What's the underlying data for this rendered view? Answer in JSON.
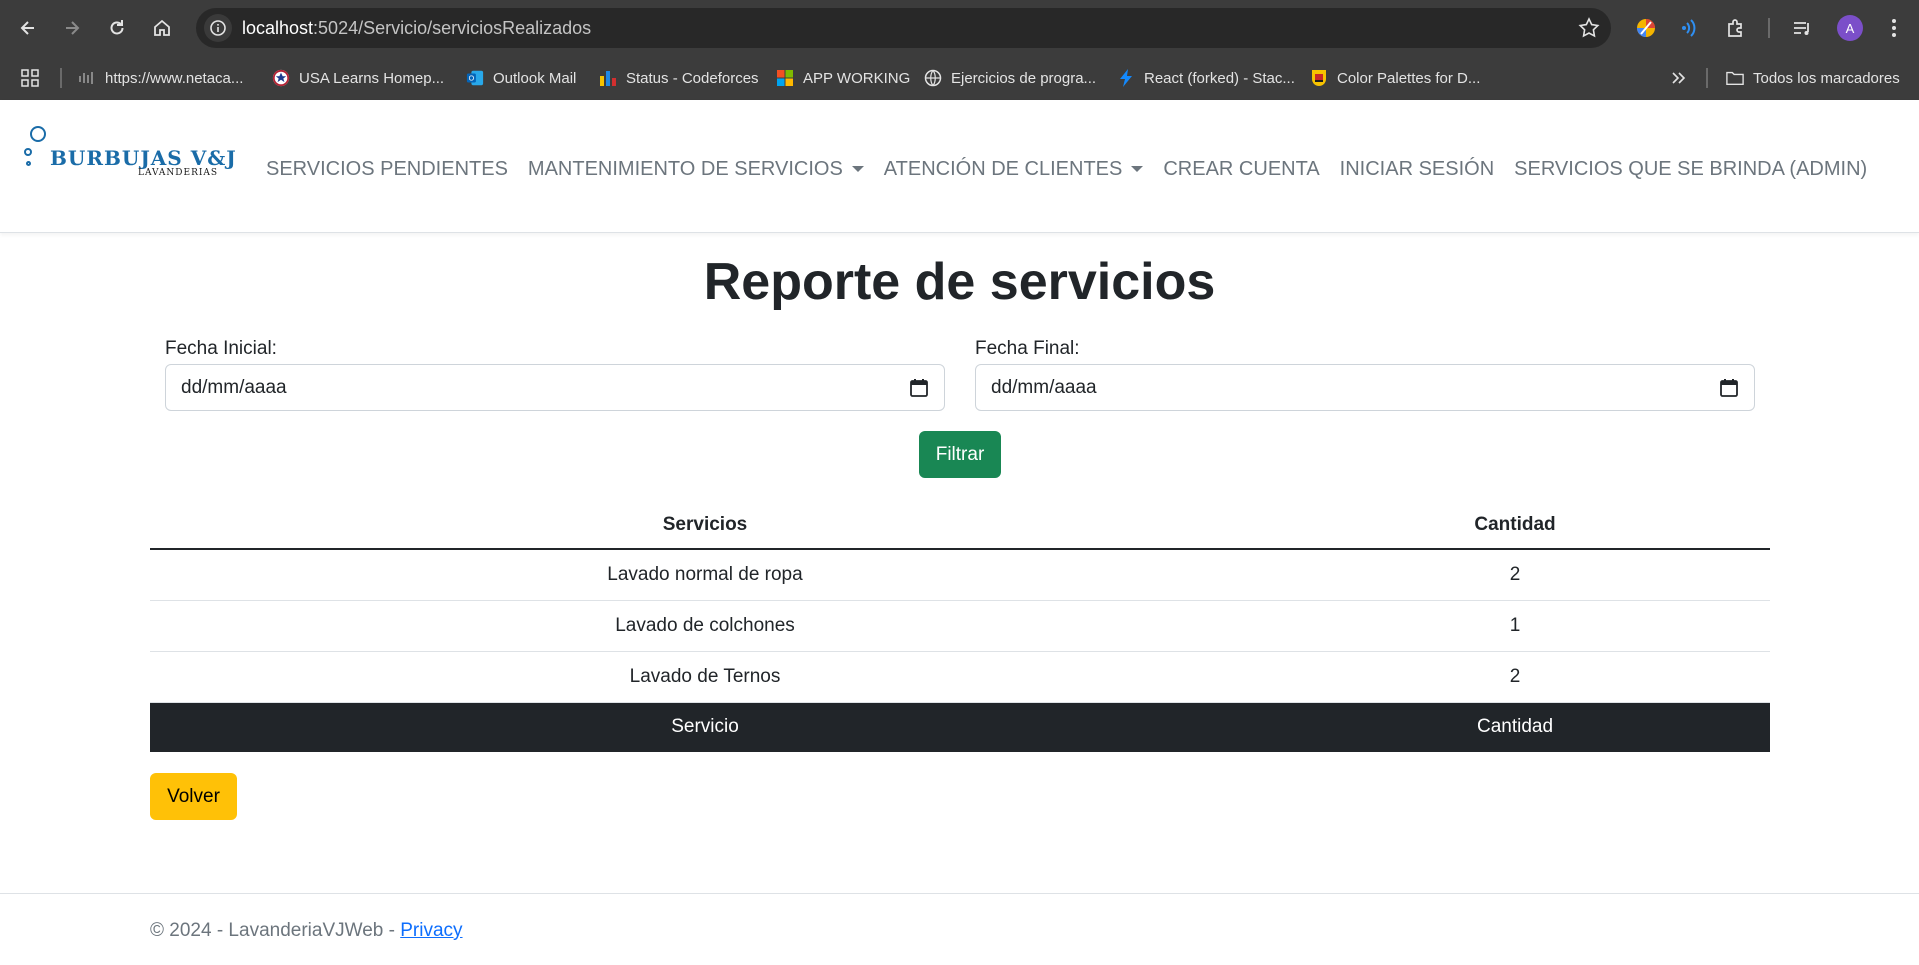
{
  "browser": {
    "url_host": "localhost",
    "url_path": ":5024/Servicio/serviciosRealizados",
    "profile_initial": "A",
    "bookmarks": [
      "https://www.netaca...",
      "USA Learns Homep...",
      "Outlook Mail",
      "Status - Codeforces",
      "APP WORKING",
      "Ejercicios de progra...",
      "React (forked) - Stac...",
      "Color Palettes for D..."
    ],
    "all_bookmarks": "Todos los marcadores"
  },
  "navbar": {
    "brand_name": "BURBUJAS V&J",
    "brand_sub": "LAVANDERIAS",
    "links": [
      "SERVICIOS PENDIENTES",
      "MANTENIMIENTO DE SERVICIOS",
      "ATENCIÓN DE CLIENTES",
      "CREAR CUENTA",
      "INICIAR SESIÓN",
      "SERVICIOS QUE SE BRINDA (ADMIN)"
    ]
  },
  "main": {
    "title": "Reporte de servicios",
    "start_label": "Fecha Inicial:",
    "start_value": "dd/mm/aaaa",
    "end_label": "Fecha Final:",
    "end_value": "dd/mm/aaaa",
    "filter_button": "Filtrar",
    "table": {
      "headers": [
        "Servicios",
        "Cantidad"
      ],
      "rows": [
        [
          "Lavado normal de ropa",
          "2"
        ],
        [
          "Lavado de colchones",
          "1"
        ],
        [
          "Lavado de Ternos",
          "2"
        ]
      ],
      "footer": [
        "Servicio",
        "Cantidad"
      ]
    },
    "back_button": "Volver"
  },
  "footer": {
    "text": "© 2024 - LavanderiaVJWeb - ",
    "privacy_link": "Privacy"
  },
  "colors": {
    "filter_button": "#198754",
    "back_button": "#ffc107",
    "table_footer": "#212529",
    "brand": "#1a6ca8"
  }
}
